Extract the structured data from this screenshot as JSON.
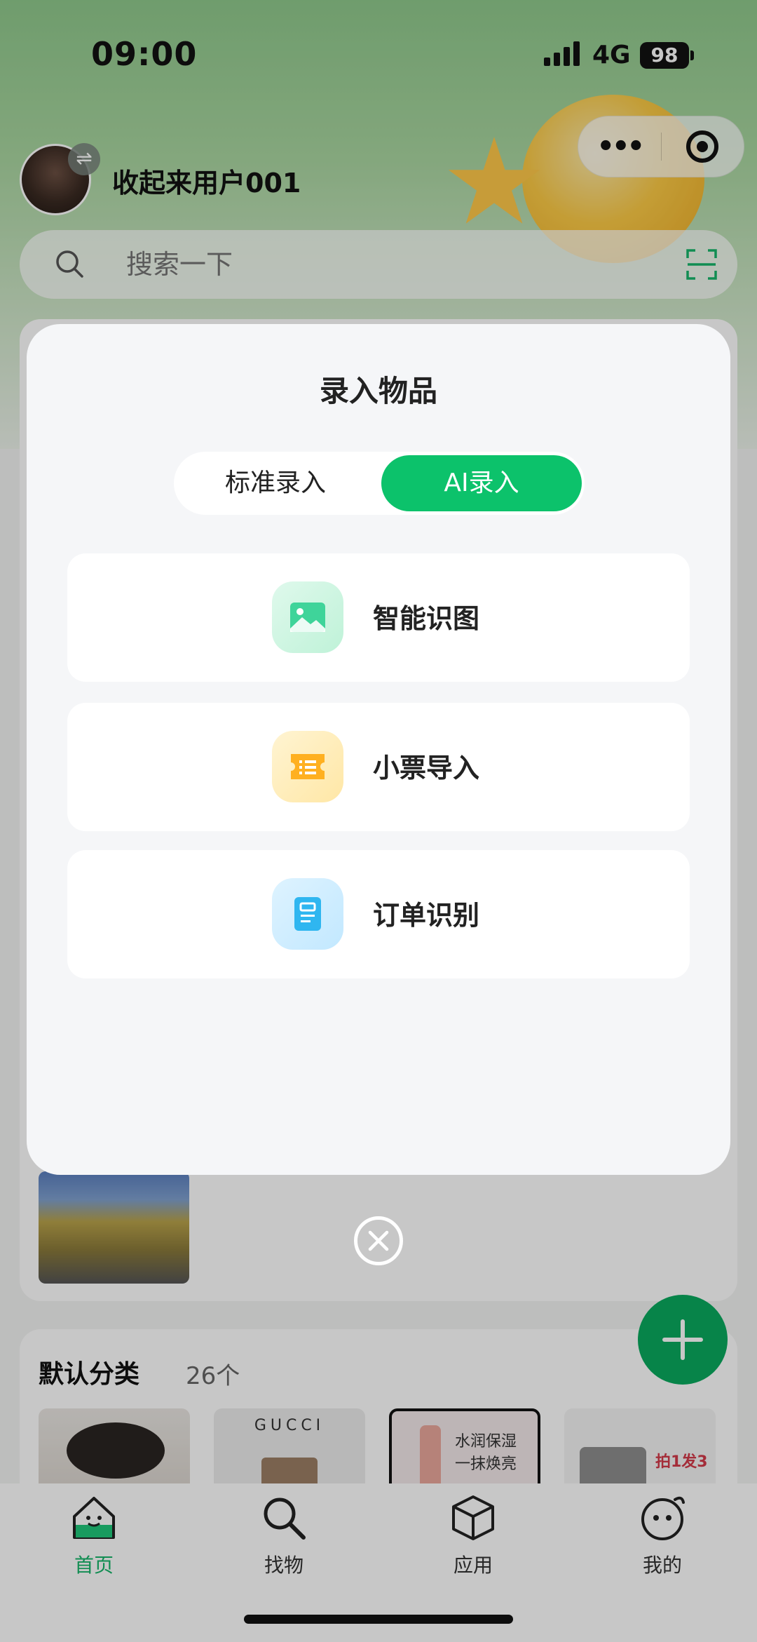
{
  "status": {
    "time": "09:00",
    "network": "4G",
    "battery": "98"
  },
  "user": {
    "name": "收起来用户001"
  },
  "search": {
    "placeholder": "搜索一下"
  },
  "category": {
    "title": "默认分类",
    "count": "26个"
  },
  "thumbs": {
    "brand": "GUCCI",
    "promo_line1": "水润保湿",
    "promo_line2": "一抹焕亮",
    "promo_deal": "拍1发3"
  },
  "modal": {
    "title": "录入物品",
    "tabs": [
      {
        "label": "标准录入",
        "active": false
      },
      {
        "label": "AI录入",
        "active": true
      }
    ],
    "options": [
      {
        "label": "智能识图",
        "icon": "image-icon"
      },
      {
        "label": "小票导入",
        "icon": "receipt-icon"
      },
      {
        "label": "订单识别",
        "icon": "order-doc-icon"
      }
    ]
  },
  "tabbar": [
    {
      "label": "首页",
      "icon": "home-icon",
      "active": true
    },
    {
      "label": "找物",
      "icon": "search-icon",
      "active": false
    },
    {
      "label": "应用",
      "icon": "box-icon",
      "active": false
    },
    {
      "label": "我的",
      "icon": "face-icon",
      "active": false
    }
  ],
  "colors": {
    "accent": "#0cc26b",
    "fab": "#0aaa5e",
    "active_tab": "#17b56a"
  }
}
